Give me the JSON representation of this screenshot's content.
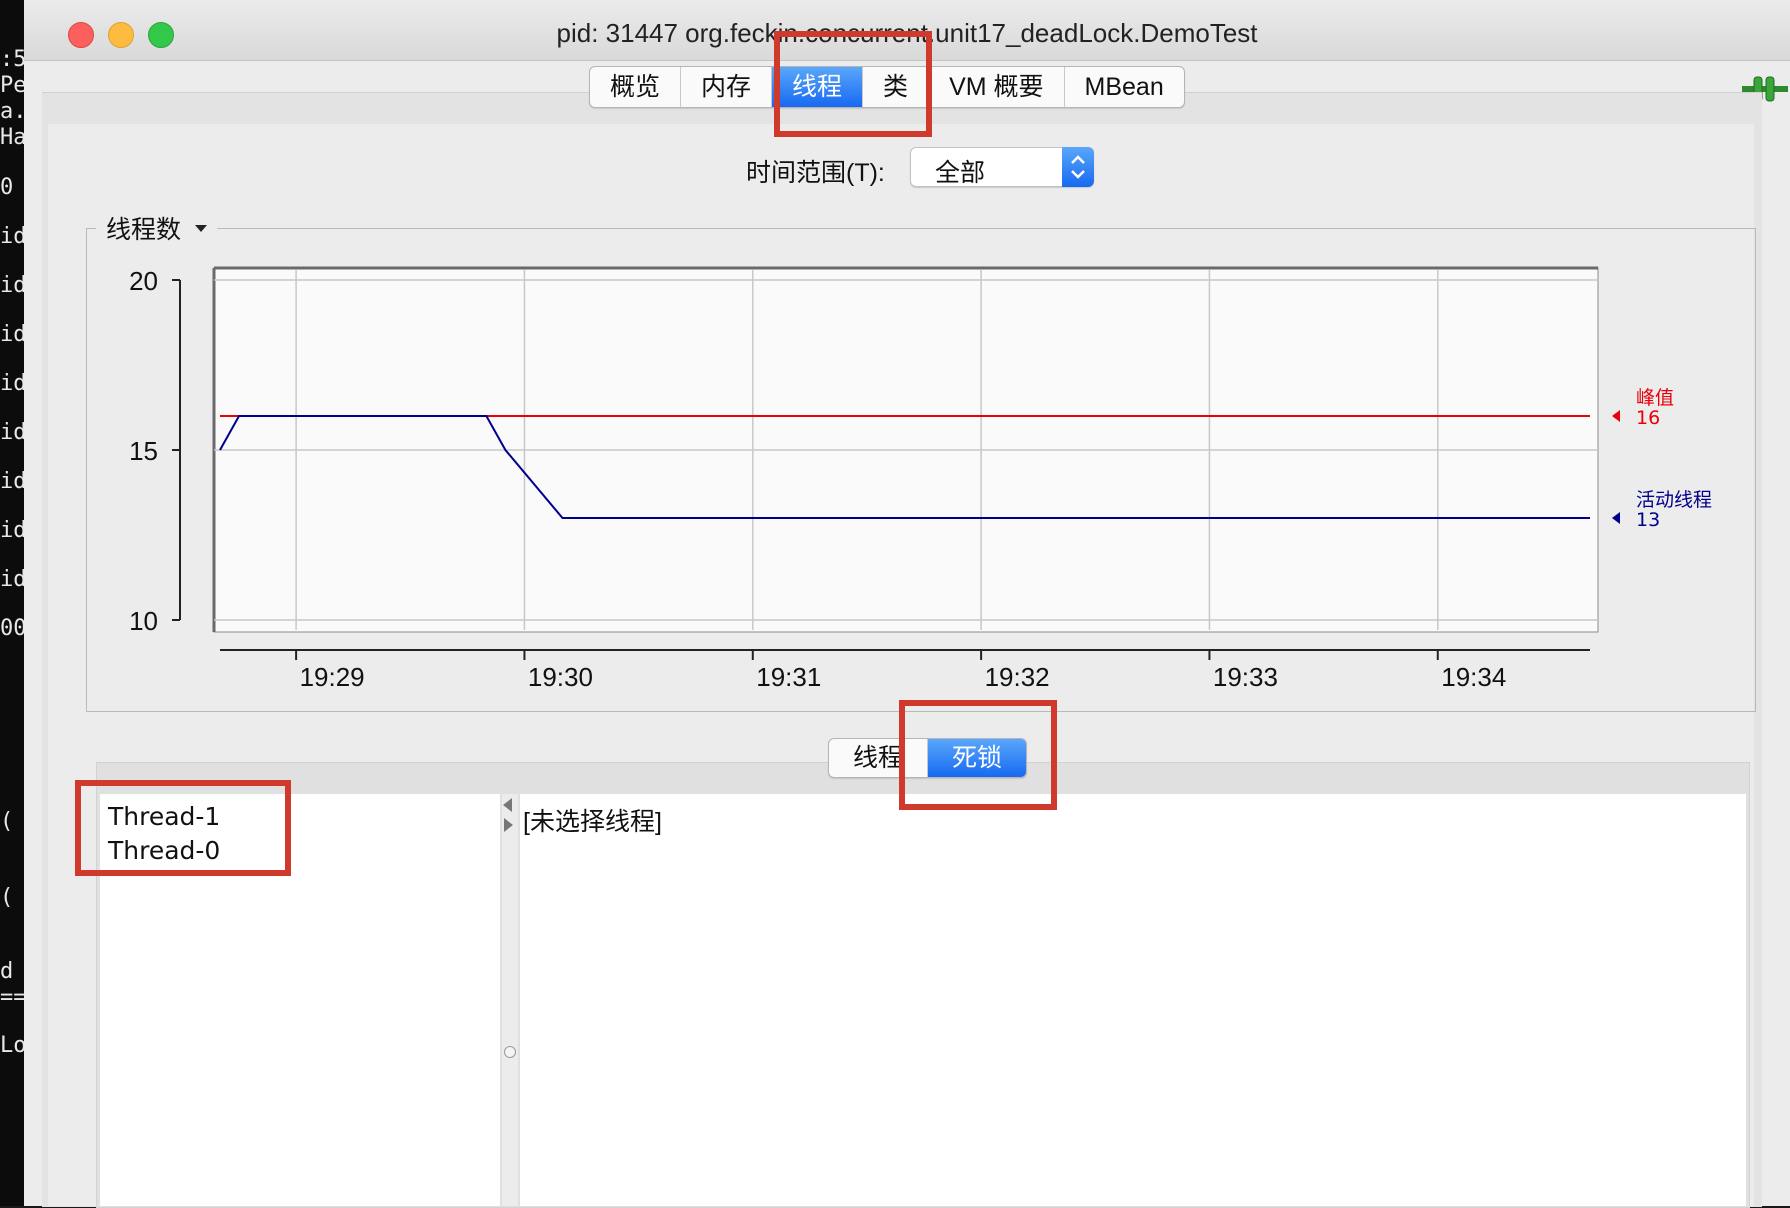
{
  "terminal_lines": [
    ":5",
    "Pe",
    "a.",
    "Ha",
    "0",
    "id",
    "id",
    "id",
    "id",
    "id",
    "id",
    "id",
    "id",
    "00",
    "(",
    "(",
    "d",
    "==",
    "Lo"
  ],
  "window": {
    "title": "pid: 31447 org.feckin.concurrent.unit17_deadLock.DemoTest"
  },
  "tabs": [
    {
      "label": "概览",
      "active": false
    },
    {
      "label": "内存",
      "active": false
    },
    {
      "label": "线程",
      "active": true
    },
    {
      "label": "类",
      "active": false
    },
    {
      "label": "VM 概要",
      "active": false
    },
    {
      "label": "MBean",
      "active": false
    }
  ],
  "time_range": {
    "label": "时间范围(T):",
    "value": "全部"
  },
  "chart_group": {
    "label": "线程数"
  },
  "chart_data": {
    "type": "line",
    "x": [
      "19:28:40",
      "19:28:45",
      "19:29:50",
      "19:29:55",
      "19:30:10",
      "19:34:40"
    ],
    "xticks": [
      "19:29",
      "19:30",
      "19:31",
      "19:32",
      "19:33",
      "19:34"
    ],
    "ylim": [
      10,
      20
    ],
    "yticks": [
      "20",
      "15",
      "10"
    ],
    "series": [
      {
        "name": "峰值",
        "label_value": "16",
        "color": "#e8000b",
        "values": [
          16,
          16,
          16,
          16,
          16,
          16
        ]
      },
      {
        "name": "活动线程",
        "label_value": "13",
        "color": "#00008b",
        "values": [
          15,
          16,
          16,
          15,
          13,
          13
        ]
      }
    ]
  },
  "subtabs": [
    {
      "label": "线程",
      "active": false
    },
    {
      "label": "死锁",
      "active": true
    }
  ],
  "threads": [
    "Thread-1",
    "Thread-0"
  ],
  "detail": {
    "placeholder": "[未选择线程]"
  },
  "colors": {
    "accent": "#1769f1",
    "highlight": "#cf3a2c"
  }
}
